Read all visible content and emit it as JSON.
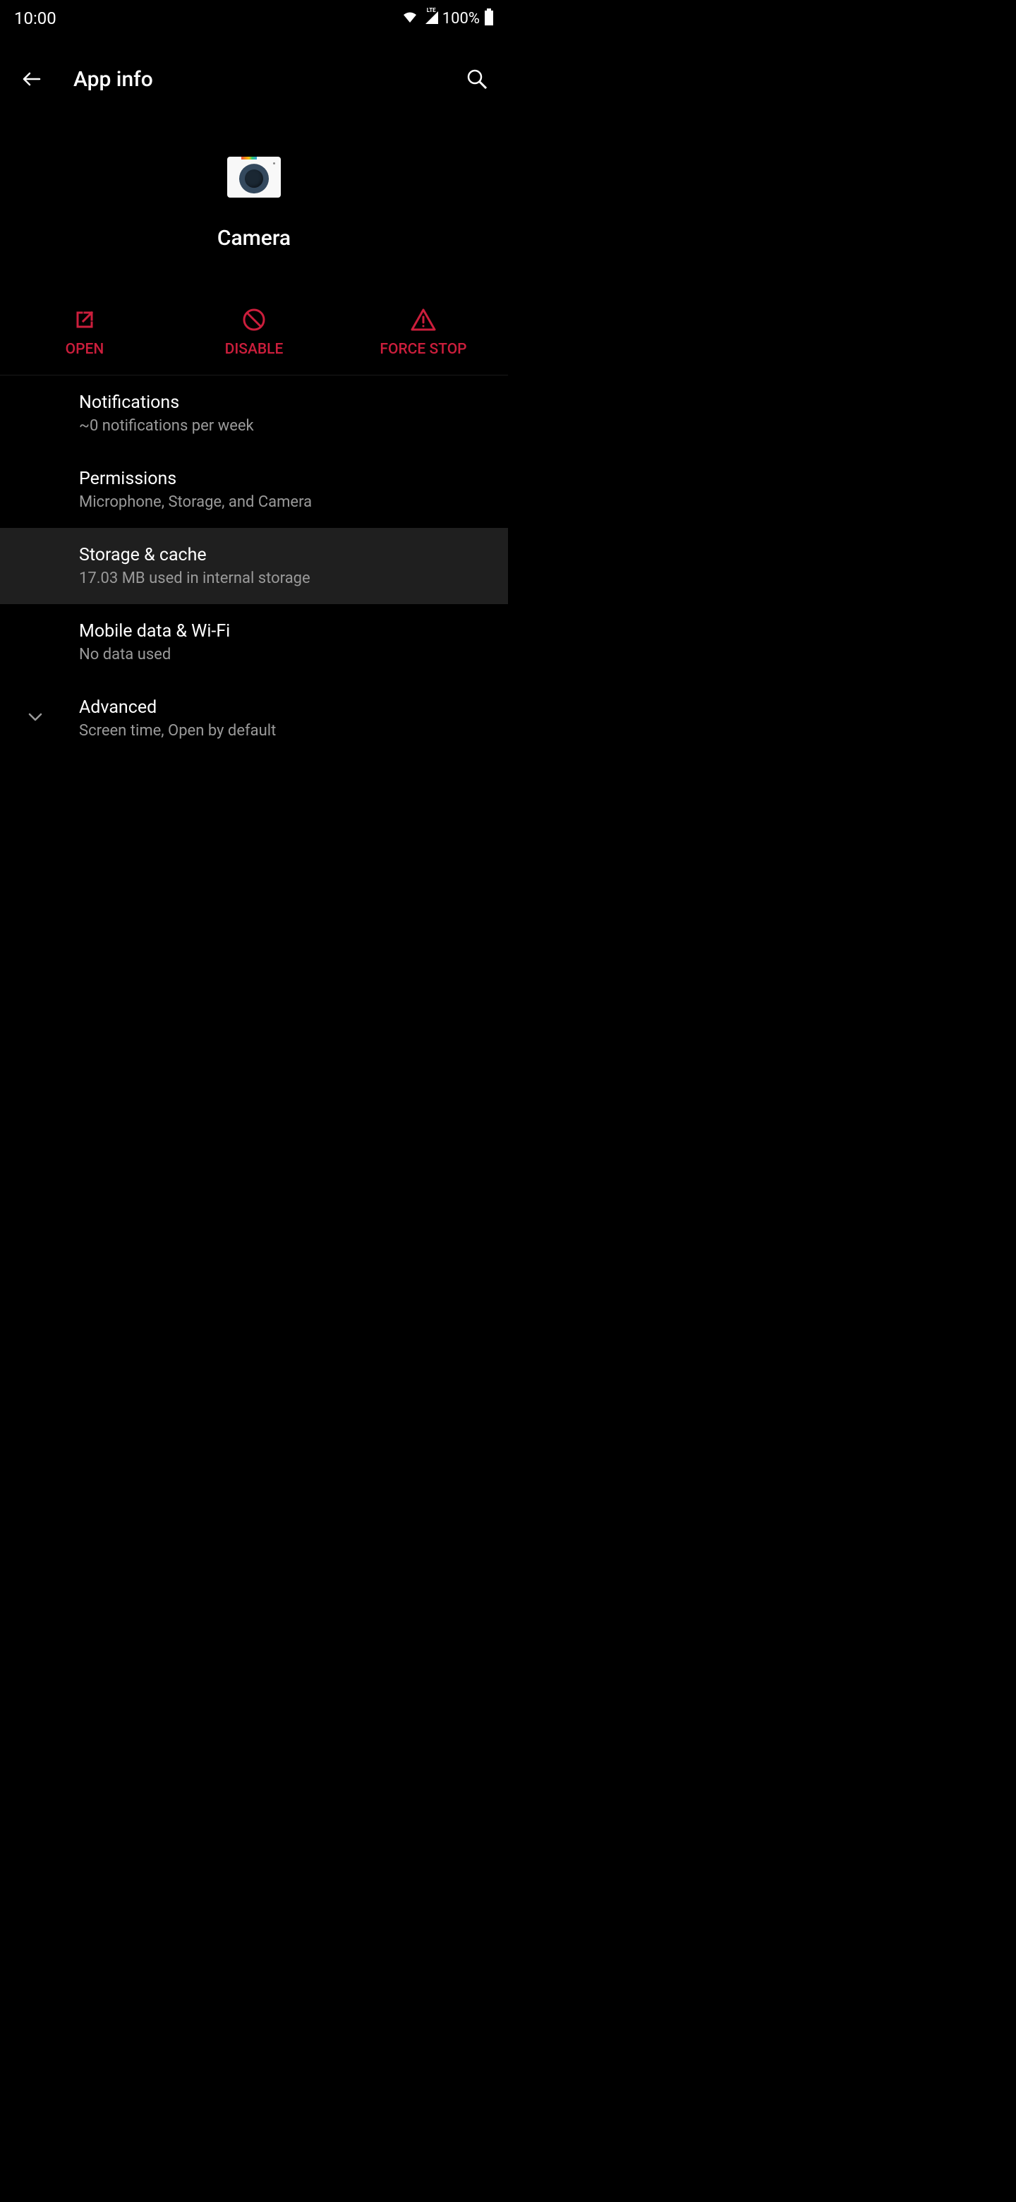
{
  "status": {
    "time": "10:00",
    "battery": "100%",
    "lte_label": "LTE"
  },
  "header": {
    "title": "App info"
  },
  "app": {
    "name": "Camera"
  },
  "actions": {
    "open": "OPEN",
    "disable": "DISABLE",
    "force_stop": "FORCE STOP"
  },
  "settings": {
    "notifications": {
      "title": "Notifications",
      "subtitle": "~0 notifications per week"
    },
    "permissions": {
      "title": "Permissions",
      "subtitle": "Microphone, Storage, and Camera"
    },
    "storage": {
      "title": "Storage & cache",
      "subtitle": "17.03 MB used in internal storage"
    },
    "data": {
      "title": "Mobile data & Wi-Fi",
      "subtitle": "No data used"
    },
    "advanced": {
      "title": "Advanced",
      "subtitle": "Screen time, Open by default"
    }
  },
  "colors": {
    "accent": "#cc1e3c",
    "background": "#000000",
    "highlight": "#1f1f1f"
  }
}
